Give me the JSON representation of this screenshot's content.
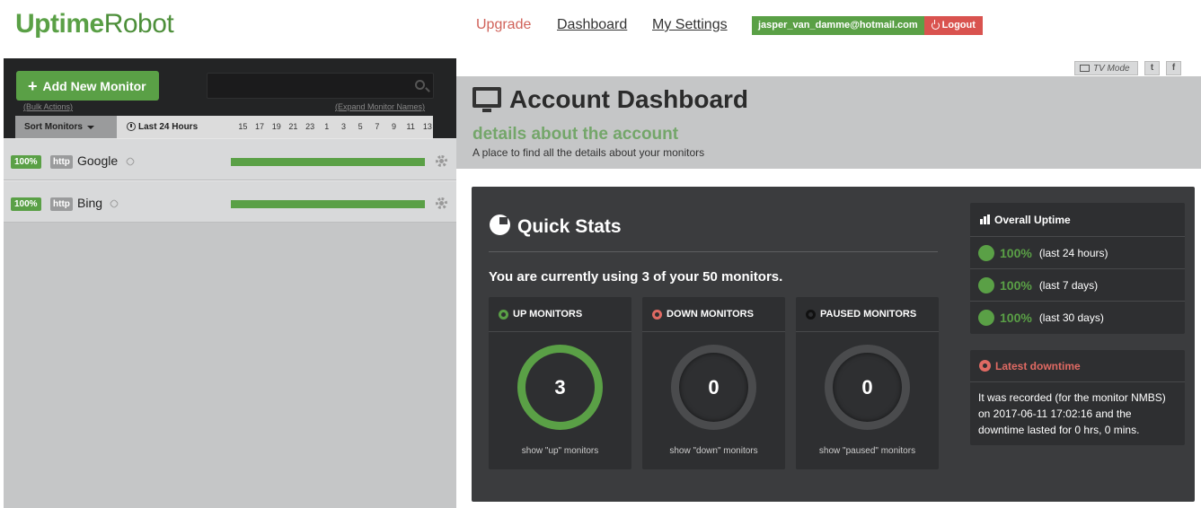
{
  "header": {
    "logo_part1": "Uptime",
    "logo_part2": "Robot",
    "nav": {
      "upgrade": "Upgrade",
      "dashboard": "Dashboard",
      "settings": "My Settings"
    },
    "account_email": "jasper_van_damme@hotmail.com",
    "logout_label": "Logout"
  },
  "sidebar": {
    "add_button_label": "Add New Monitor",
    "bulk_actions": "(Bulk Actions)",
    "search_placeholder": "",
    "expand_names": "(Expand Monitor Names)",
    "sort_label": "Sort Monitors",
    "time_label": "Last 24 Hours",
    "hours": [
      "15",
      "17",
      "19",
      "21",
      "23",
      "1",
      "3",
      "5",
      "7",
      "9",
      "11",
      "13"
    ],
    "monitors": [
      {
        "uptime": "100%",
        "type": "http",
        "name": "Google"
      },
      {
        "uptime": "100%",
        "type": "http",
        "name": "Bing"
      }
    ]
  },
  "toolbar": {
    "tv_mode": "TV Mode",
    "twitter": "t",
    "facebook": "f"
  },
  "page": {
    "title": "Account Dashboard",
    "subtitle": "details about the account",
    "description": "A place to find all the details about your monitors"
  },
  "quick_stats": {
    "title": "Quick Stats",
    "usage_text": "You are currently using 3 of your 50 monitors.",
    "cards": [
      {
        "label": "UP MONITORS",
        "count": "3",
        "link": "show \"up\" monitors",
        "color": "#5aa046"
      },
      {
        "label": "DOWN MONITORS",
        "count": "0",
        "link": "show \"down\" monitors",
        "color": "#e06a63"
      },
      {
        "label": "PAUSED MONITORS",
        "count": "0",
        "link": "show \"paused\" monitors",
        "color": "#222222"
      }
    ]
  },
  "overall_uptime": {
    "title": "Overall Uptime",
    "rows": [
      {
        "value": "100%",
        "period": "(last 24 hours)"
      },
      {
        "value": "100%",
        "period": "(last 7 days)"
      },
      {
        "value": "100%",
        "period": "(last 30 days)"
      }
    ]
  },
  "latest_downtime": {
    "title": "Latest downtime",
    "text": "It was recorded (for the monitor NMBS) on 2017-06-11 17:02:16 and the downtime lasted for 0 hrs, 0 mins."
  },
  "colors": {
    "brand_green": "#5aa046",
    "danger_red": "#d9534f",
    "panel_dark": "#3b3c3e"
  }
}
